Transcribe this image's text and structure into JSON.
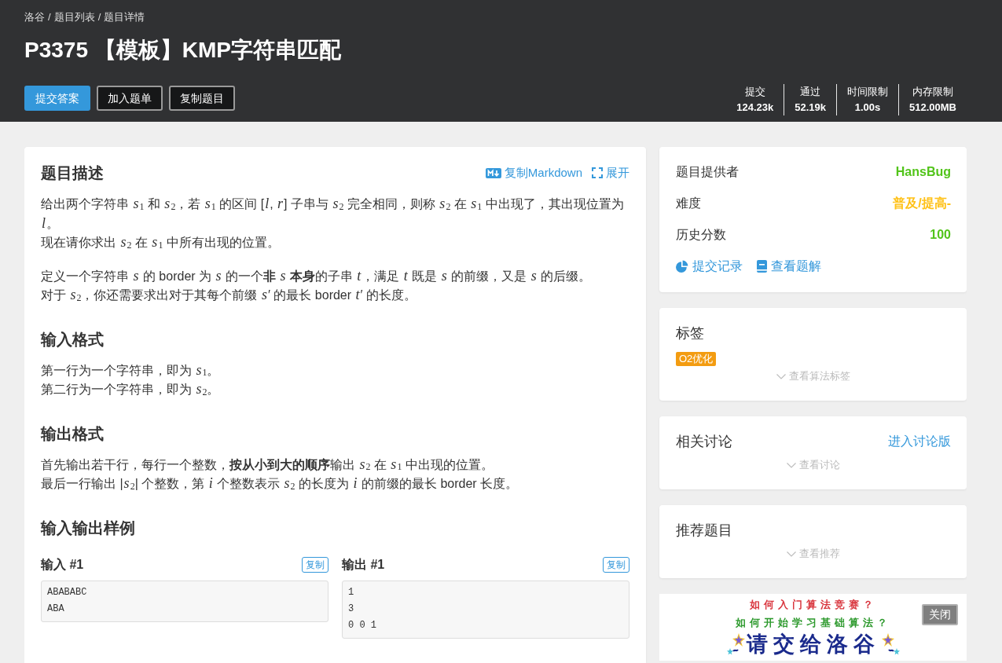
{
  "breadcrumb": {
    "items": [
      "洛谷",
      "题目列表",
      "题目详情"
    ],
    "separator": "/"
  },
  "title": "P3375 【模板】KMP字符串匹配",
  "actions": [
    {
      "label": "提交答案",
      "kind": "primary"
    },
    {
      "label": "加入题单",
      "kind": "outline"
    },
    {
      "label": "复制题目",
      "kind": "outline"
    }
  ],
  "stats": [
    {
      "label": "提交",
      "value": "124.23k"
    },
    {
      "label": "通过",
      "value": "52.19k"
    },
    {
      "label": "时间限制",
      "value": "1.00s"
    },
    {
      "label": "内存限制",
      "value": "512.00MB"
    }
  ],
  "problem": {
    "toolbar": [
      {
        "label": "复制Markdown",
        "kind": "markdown"
      },
      {
        "label": "展开",
        "kind": "expand"
      }
    ],
    "sections": [
      {
        "heading": "题目描述",
        "paragraphs": [
          [
            "给出两个字符串 *s*$_{1}$ 和 *s*$_{2}$，若 *s*$_{1}$ 的区间 [*l*, *r*] 子串与 *s*$_{2}$ 完全相同，则称 *s*$_{2}$ 在 *s*$_{1}$ 中出现了，其出现位置为 *l*。",
            "现在请你求出 *s*$_{2}$ 在 *s*$_{1}$ 中所有出现的位置。"
          ],
          [
            "定义一个字符串 *s* 的 border 为 *s* 的一个**非** *s* **本身**的子串 *t*，满足 *t* 既是 *s* 的前缀，又是 *s* 的后缀。",
            "对于 *s*$_{2}$，你还需要求出对于其每个前缀 *s*′ 的最长 border *t*′ 的长度。"
          ]
        ]
      },
      {
        "heading": "输入格式",
        "paragraphs": [
          [
            "第一行为一个字符串，即为 *s*$_{1}$。",
            "第二行为一个字符串，即为 *s*$_{2}$。"
          ]
        ]
      },
      {
        "heading": "输出格式",
        "paragraphs": [
          [
            "首先输出若干行，每行一个整数，**按从小到大的顺序**输出 *s*$_{2}$ 在 *s*$_{1}$ 中出现的位置。",
            "最后一行输出 |*s*$_{2}$| 个整数，第 *i* 个整数表示 *s*$_{2}$ 的长度为 *i* 的前缀的最长 border 长度。"
          ]
        ]
      }
    ],
    "samples_heading": "输入输出样例",
    "samples": [
      {
        "label": "输入 #1",
        "copy": "复制",
        "lines": [
          "ABABABC",
          "ABA"
        ]
      },
      {
        "label": "输出 #1",
        "copy": "复制",
        "lines": [
          "1",
          "3",
          "0 0 1"
        ]
      }
    ]
  },
  "sidebar": {
    "info": {
      "rows": [
        {
          "label": "题目提供者",
          "value": "HansBug",
          "color": "#52c41a"
        },
        {
          "label": "难度",
          "value": "普及/提高-",
          "color": "#ffc116"
        },
        {
          "label": "历史分数",
          "value": "100",
          "color": "#52c41a"
        }
      ],
      "links": [
        {
          "label": "提交记录",
          "kind": "records"
        },
        {
          "label": "查看题解",
          "kind": "solutions"
        }
      ]
    },
    "tags_card": {
      "title": "标签",
      "tags": [
        {
          "label": "O2优化",
          "color": "#f39c11"
        }
      ],
      "toggle": "查看算法标签"
    },
    "discussion": {
      "title": "相关讨论",
      "link": "进入讨论版",
      "toggle": "查看讨论"
    },
    "recommend": {
      "title": "推荐题目",
      "toggle": "查看推荐"
    },
    "ad": {
      "lines": [
        {
          "text": "如何入门算法竞赛？",
          "color": "#d9363e"
        },
        {
          "text": "如何开始学习基础算法？",
          "color": "#2e9a2e"
        },
        {
          "text": "请交给洛谷",
          "color": "#1a2a8c"
        }
      ],
      "close": "关闭"
    }
  }
}
